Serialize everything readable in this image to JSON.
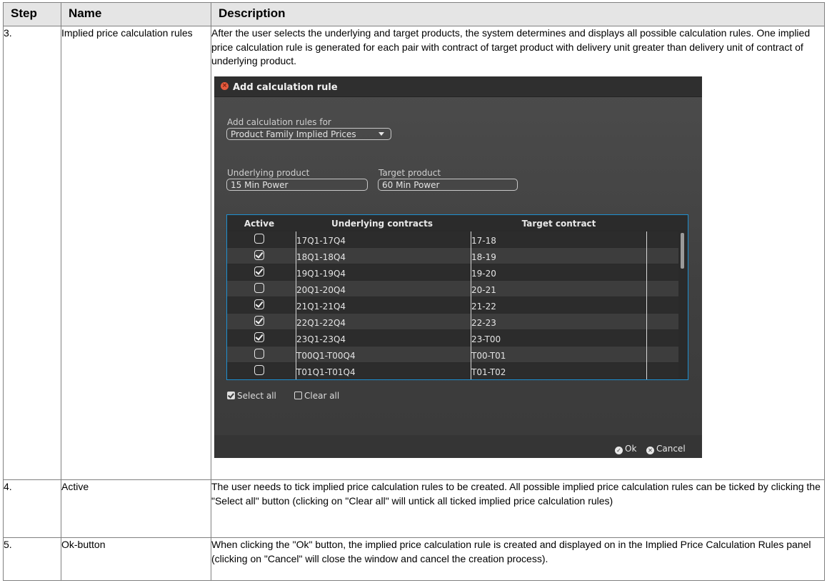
{
  "table": {
    "headers": {
      "step": "Step",
      "name": "Name",
      "description": "Description"
    },
    "rows": [
      {
        "step": "3.",
        "name": "Implied price calculation rules",
        "description": "After the user selects the underlying and target products, the system determines and displays all possible calculation rules. One implied price calculation rule is generated for each pair with contract of target product with delivery unit greater than delivery unit of contract of underlying product."
      },
      {
        "step": "4.",
        "name": "Active",
        "description": "The user needs to tick implied price calculation rules to be created. All possible implied price calculation rules can be ticked by clicking the \"Select all\" button (clicking on \"Clear all\" will untick all ticked implied price calculation rules)"
      },
      {
        "step": "5.",
        "name": "Ok-button",
        "description": "When clicking the \"Ok\" button, the implied price calculation rule is created and displayed on in the Implied Price Calculation Rules panel (clicking on \"Cancel\" will close the window and cancel the creation process)."
      }
    ]
  },
  "dialog": {
    "title": "Add calculation rule",
    "rules_for_label": "Add calculation rules for",
    "rules_for_value": "Product Family Implied Prices",
    "underlying_label": "Underlying product",
    "underlying_value": "15 Min Power",
    "target_label": "Target product",
    "target_value": "60 Min Power",
    "grid_headers": {
      "active": "Active",
      "underlying": "Underlying contracts",
      "target": "Target contract"
    },
    "grid_rows": [
      {
        "active": false,
        "underlying": "17Q1-17Q4",
        "target": "17-18"
      },
      {
        "active": true,
        "underlying": "18Q1-18Q4",
        "target": "18-19"
      },
      {
        "active": true,
        "underlying": "19Q1-19Q4",
        "target": "19-20"
      },
      {
        "active": false,
        "underlying": "20Q1-20Q4",
        "target": "20-21"
      },
      {
        "active": true,
        "underlying": "21Q1-21Q4",
        "target": "21-22"
      },
      {
        "active": true,
        "underlying": "22Q1-22Q4",
        "target": "22-23"
      },
      {
        "active": true,
        "underlying": "23Q1-23Q4",
        "target": "23-T00"
      },
      {
        "active": false,
        "underlying": "T00Q1-T00Q4",
        "target": "T00-T01"
      },
      {
        "active": false,
        "underlying": "T01Q1-T01Q4",
        "target": "T01-T02"
      }
    ],
    "select_all_label": "Select all",
    "clear_all_label": "Clear all",
    "ok_label": "Ok",
    "cancel_label": "Cancel"
  },
  "colors": {
    "header_bg": "#e5e5e5",
    "dialog_bg": "#444444",
    "grid_border": "#1e8fd0",
    "close_icon": "#e65b3e"
  }
}
